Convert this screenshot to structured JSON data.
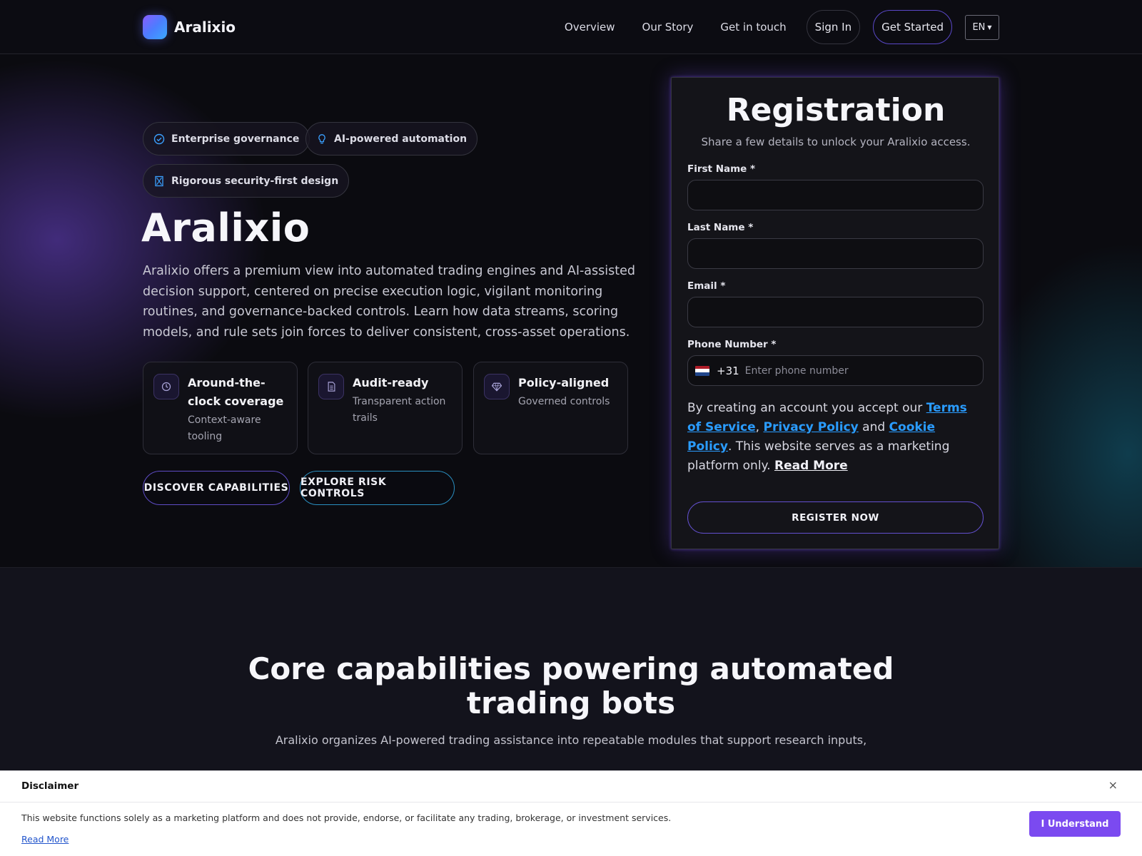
{
  "header": {
    "brand": "Aralixio",
    "nav": [
      "Overview",
      "Our Story",
      "Get in touch"
    ],
    "sign_in": "Sign In",
    "get_started": "Get Started",
    "language": "EN"
  },
  "hero": {
    "badges": [
      "Enterprise governance",
      "AI-powered automation",
      "Rigorous security-first design"
    ],
    "title": "Aralixio",
    "description": "Aralixio offers a premium view into automated trading engines and AI-assisted decision support, centered on precise execution logic, vigilant monitoring routines, and governance-backed controls. Learn how data streams, scoring models, and rule sets join forces to deliver consistent, cross-asset operations.",
    "features": [
      {
        "title": "Around-the-clock coverage",
        "subtitle": "Context-aware tooling",
        "icon": "clock-icon"
      },
      {
        "title": "Audit-ready",
        "subtitle": "Transparent action trails",
        "icon": "document-icon"
      },
      {
        "title": "Policy-aligned",
        "subtitle": "Governed controls",
        "icon": "diamond-icon"
      }
    ],
    "cta_primary": "DISCOVER CAPABILITIES",
    "cta_secondary": "EXPLORE RISK CONTROLS"
  },
  "form": {
    "title": "Registration",
    "subtitle": "Share a few details to unlock your Aralixio access.",
    "first_name_label": "First Name *",
    "first_name_value": "",
    "last_name_label": "Last Name *",
    "last_name_value": "",
    "email_label": "Email *",
    "email_value": "",
    "phone_label": "Phone Number *",
    "dial_code": "+31",
    "phone_placeholder": "Enter phone number",
    "terms_prefix": "By creating an account you accept our",
    "terms_link": "Terms of Service",
    "comma": ",",
    "privacy_link": "Privacy Policy",
    "and": "and",
    "cookie_link": "Cookie Policy",
    "terms_suffix": ". This website serves as a marketing platform only.",
    "read_more": "Read More",
    "submit": "REGISTER NOW"
  },
  "capabilities": {
    "title": "Core capabilities powering automated trading bots",
    "description": "Aralixio organizes AI-powered trading assistance into repeatable modules that support research inputs,"
  },
  "disclaimer": {
    "title": "Disclaimer",
    "close": "×",
    "text": "This website functions solely as a marketing platform and does not provide, endorse, or facilitate any trading, brokerage, or investment services.",
    "read_more": "Read More",
    "button": "I Understand"
  },
  "colors": {
    "accent_purple": "#7b4af0",
    "link_blue": "#2a9cff",
    "badge_icon_blue": "#3aa0ff"
  }
}
